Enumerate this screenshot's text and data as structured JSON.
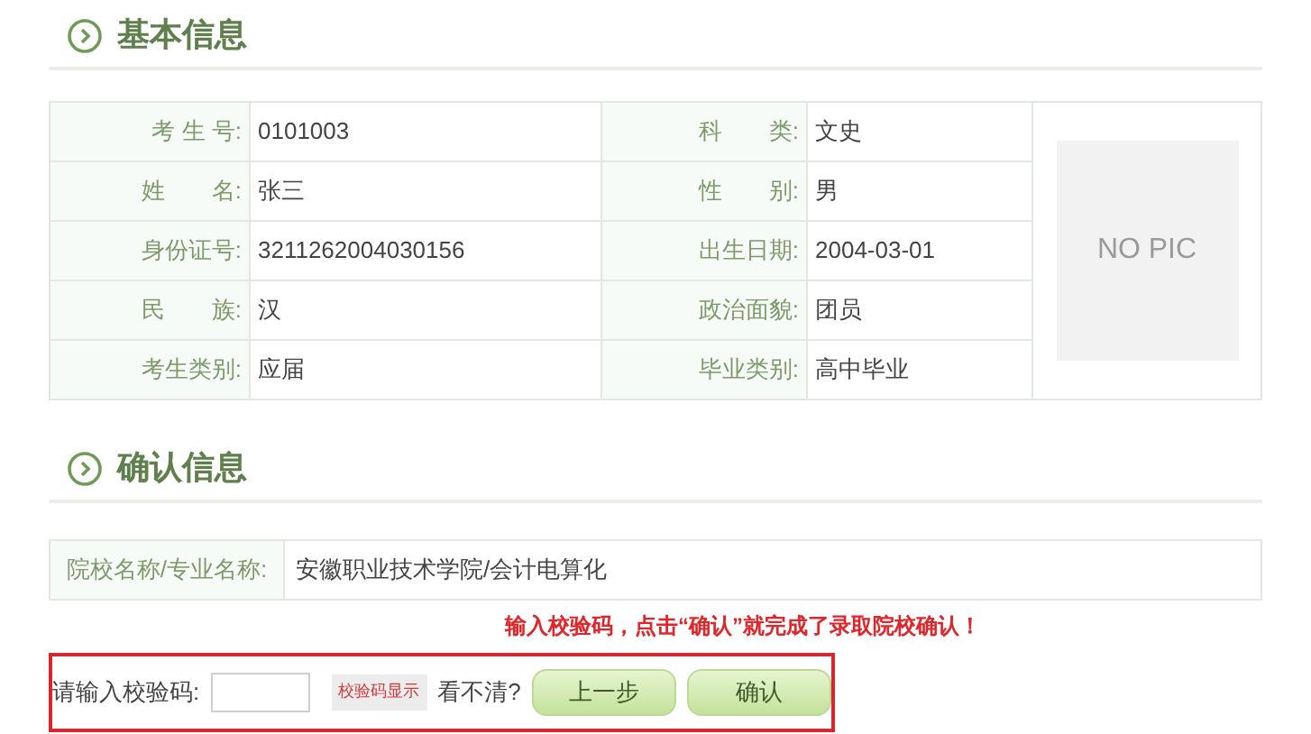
{
  "basic_section": {
    "title": "基本信息"
  },
  "basic_rows": [
    {
      "label_1": "考 生 号:",
      "value_1": "0101003",
      "label_2": "科　　类:",
      "value_2": "文史"
    },
    {
      "label_1": "姓　　名:",
      "value_1": "张三",
      "label_2": "性　　别:",
      "value_2": "男"
    },
    {
      "label_1": "身份证号:",
      "value_1": "3211262004030156",
      "label_2": "出生日期:",
      "value_2": "2004-03-01"
    },
    {
      "label_1": "民　　族:",
      "value_1": "汉",
      "label_2": "政治面貌:",
      "value_2": "团员"
    },
    {
      "label_1": "考生类别:",
      "value_1": "应届",
      "label_2": "毕业类别:",
      "value_2": "高中毕业"
    }
  ],
  "photo": {
    "text": "NO PIC"
  },
  "confirm_section": {
    "title": "确认信息"
  },
  "school_row": {
    "label": "院校名称/专业名称:",
    "value": "安徽职业技术学院/会计电算化"
  },
  "annotation": "输入校验码，点击“确认”就完成了录取院校确认！",
  "captcha": {
    "label": "请输入校验码:",
    "image_text": "校验码显示",
    "refresh": "看不清?"
  },
  "buttons": [
    "上一步",
    "确认"
  ]
}
